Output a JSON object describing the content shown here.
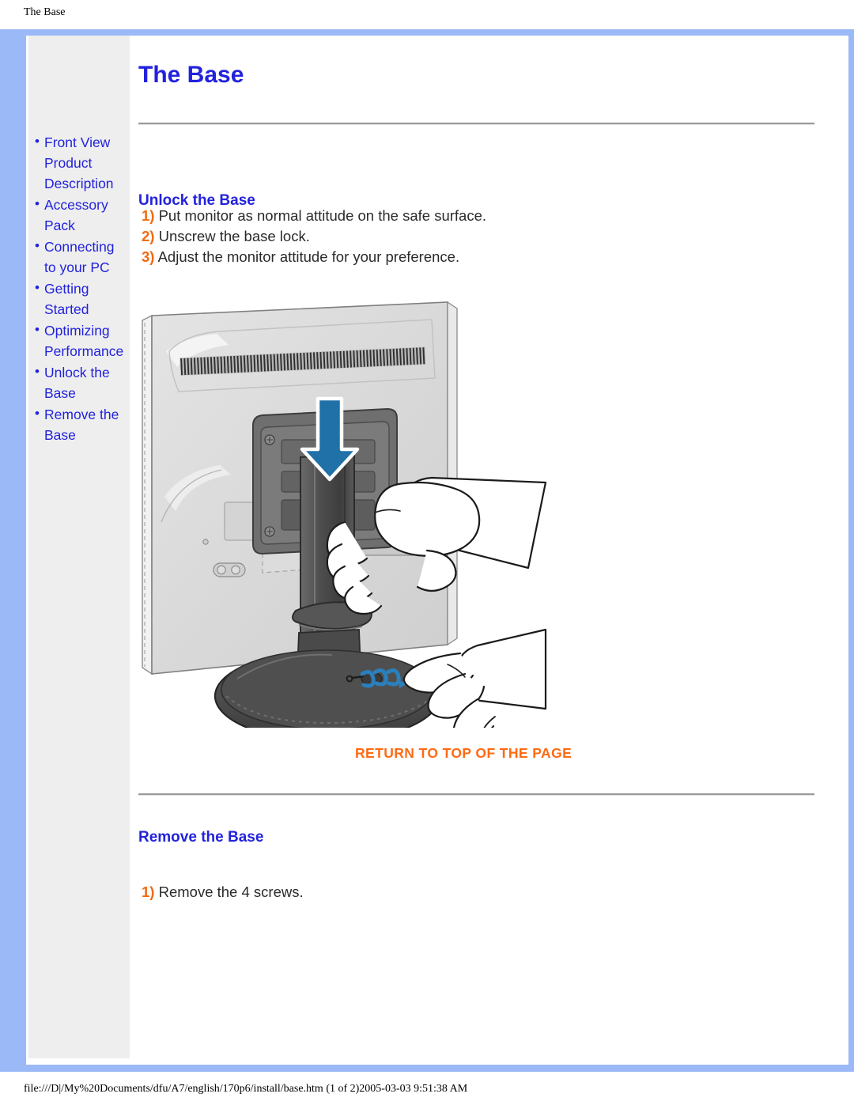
{
  "browser_chrome": {
    "print_header": "The Base",
    "print_footer": "file:///D|/My%20Documents/dfu/A7/english/170p6/install/base.htm (1 of 2)2005-03-03 9:51:38 AM"
  },
  "colors": {
    "frame_blue": "#9cb9f7",
    "sidebar_grey": "#eeeeee",
    "link_blue": "#2222dd",
    "accent_orange": "#ff6a13",
    "step_number_orange": "#f06a10",
    "body_text": "#2a2a2a",
    "rule_grey": "#9a9a9a",
    "arrow_blue": "#1f71a8"
  },
  "sidebar": {
    "bullet_glyph": "•",
    "items": [
      {
        "label": "Front View Product Description",
        "name": "front-view-product-description"
      },
      {
        "label": "Accessory Pack",
        "name": "accessory-pack"
      },
      {
        "label": "Connecting to your PC",
        "name": "connecting-to-your-pc"
      },
      {
        "label": "Getting Started",
        "name": "getting-started"
      },
      {
        "label": "Optimizing Performance",
        "name": "optimizing-performance"
      },
      {
        "label": "Unlock the Base",
        "name": "unlock-the-base"
      },
      {
        "label": "Remove the Base",
        "name": "remove-the-base"
      }
    ]
  },
  "main": {
    "title": "The Base",
    "unlock_section": {
      "heading": "Unlock the Base",
      "steps": [
        {
          "num": "1)",
          "text": "Put monitor as normal attitude on the safe surface."
        },
        {
          "num": "2)",
          "text": "Unscrew the base lock."
        },
        {
          "num": "3)",
          "text": "Adjust the monitor attitude for your preference."
        }
      ],
      "illustration": {
        "name": "monitor-base-unlock-illustration",
        "arrow_hint": "downward-arrow",
        "rotate_hint": "unscrew-rotation-arrow"
      }
    },
    "return_to_top": "RETURN TO TOP OF THE PAGE",
    "remove_section": {
      "heading": "Remove the Base",
      "steps": [
        {
          "num": "1)",
          "text": "Remove the 4 screws."
        }
      ]
    }
  }
}
